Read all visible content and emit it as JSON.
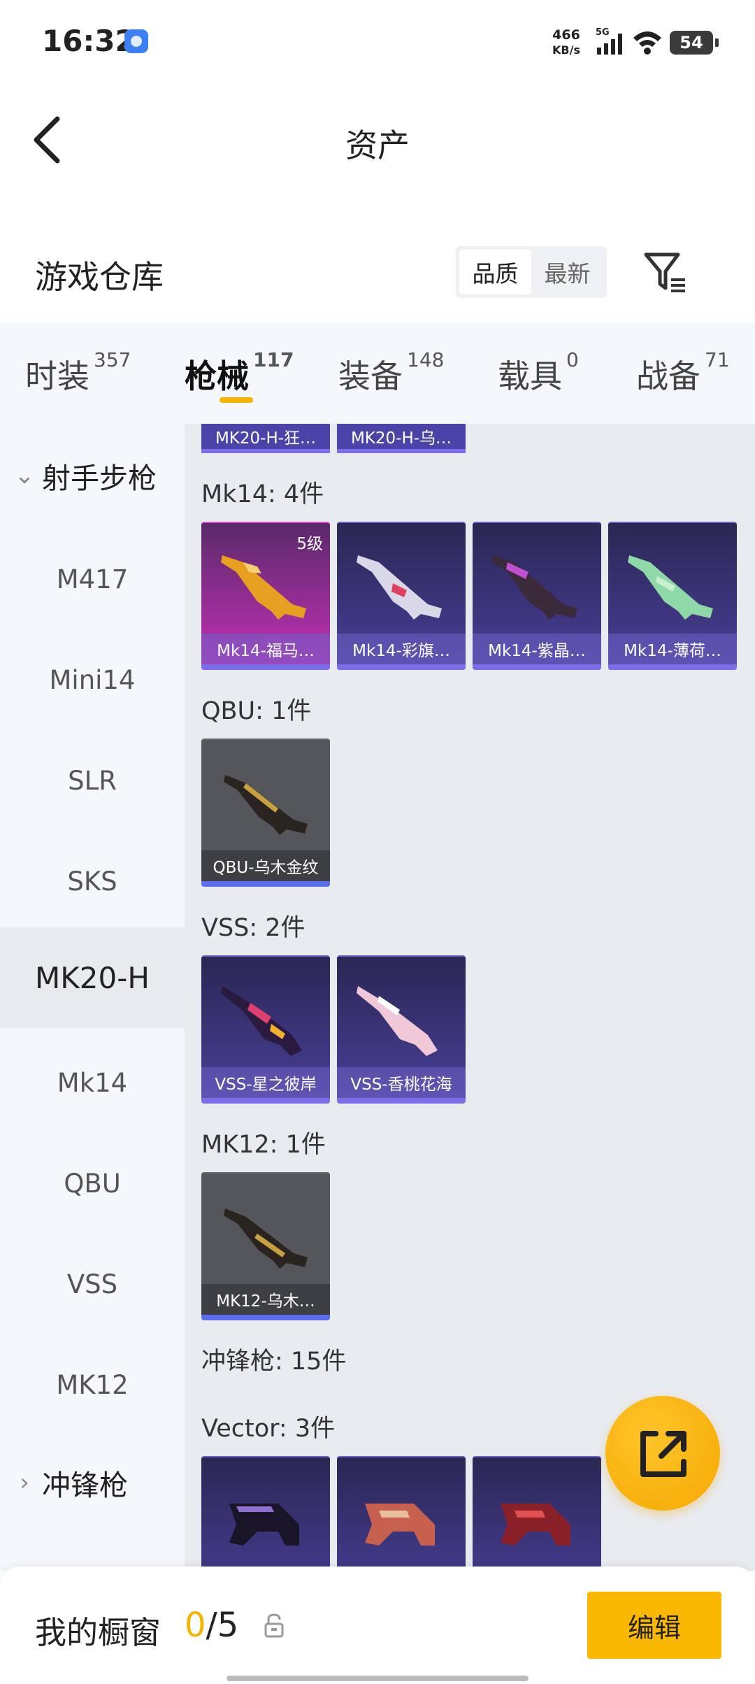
{
  "status": {
    "time": "16:32",
    "speed_value": "466",
    "speed_unit": "KB/s",
    "network": "5G",
    "battery": "54"
  },
  "nav": {
    "title": "资产"
  },
  "warehouse": {
    "title": "游戏仓库",
    "sort_quality": "品质",
    "sort_latest": "最新"
  },
  "tabs": [
    {
      "label": "时装",
      "count": "357"
    },
    {
      "label": "枪械",
      "count": "117"
    },
    {
      "label": "装备",
      "count": "148"
    },
    {
      "label": "载具",
      "count": "0"
    },
    {
      "label": "战备",
      "count": "71"
    }
  ],
  "sidebar": {
    "group1": "射手步枪",
    "items": [
      "M417",
      "Mini14",
      "SLR",
      "SKS",
      "MK20-H",
      "Mk14",
      "QBU",
      "VSS",
      "MK12"
    ],
    "active": "MK20-H",
    "group2": "冲锋枪"
  },
  "content": {
    "top_cards": [
      "MK20-H-狂…",
      "MK20-H-乌…"
    ],
    "sections": [
      {
        "label": "Mk14: 4件",
        "cards": [
          {
            "name": "Mk14-福马…",
            "level": "5级"
          },
          {
            "name": "Mk14-彩旗…"
          },
          {
            "name": "Mk14-紫晶…"
          },
          {
            "name": "Mk14-薄荷…"
          }
        ]
      },
      {
        "label": "QBU: 1件",
        "cards": [
          {
            "name": "QBU-乌木金纹"
          }
        ]
      },
      {
        "label": "VSS: 2件",
        "cards": [
          {
            "name": "VSS-星之彼岸"
          },
          {
            "name": "VSS-香桃花海"
          }
        ]
      },
      {
        "label": "MK12: 1件",
        "cards": [
          {
            "name": "MK12-乌木…"
          }
        ]
      },
      {
        "label": "冲锋枪: 15件"
      },
      {
        "label": "Vector: 3件"
      }
    ]
  },
  "bottom": {
    "showcase_label": "我的橱窗",
    "current": "0",
    "total": "/5",
    "edit": "编辑"
  },
  "colors": {
    "accent": "#f5b400",
    "card_purple": "#4a3f99",
    "card_pink": "#c630b8",
    "card_gray": "#55565c"
  }
}
